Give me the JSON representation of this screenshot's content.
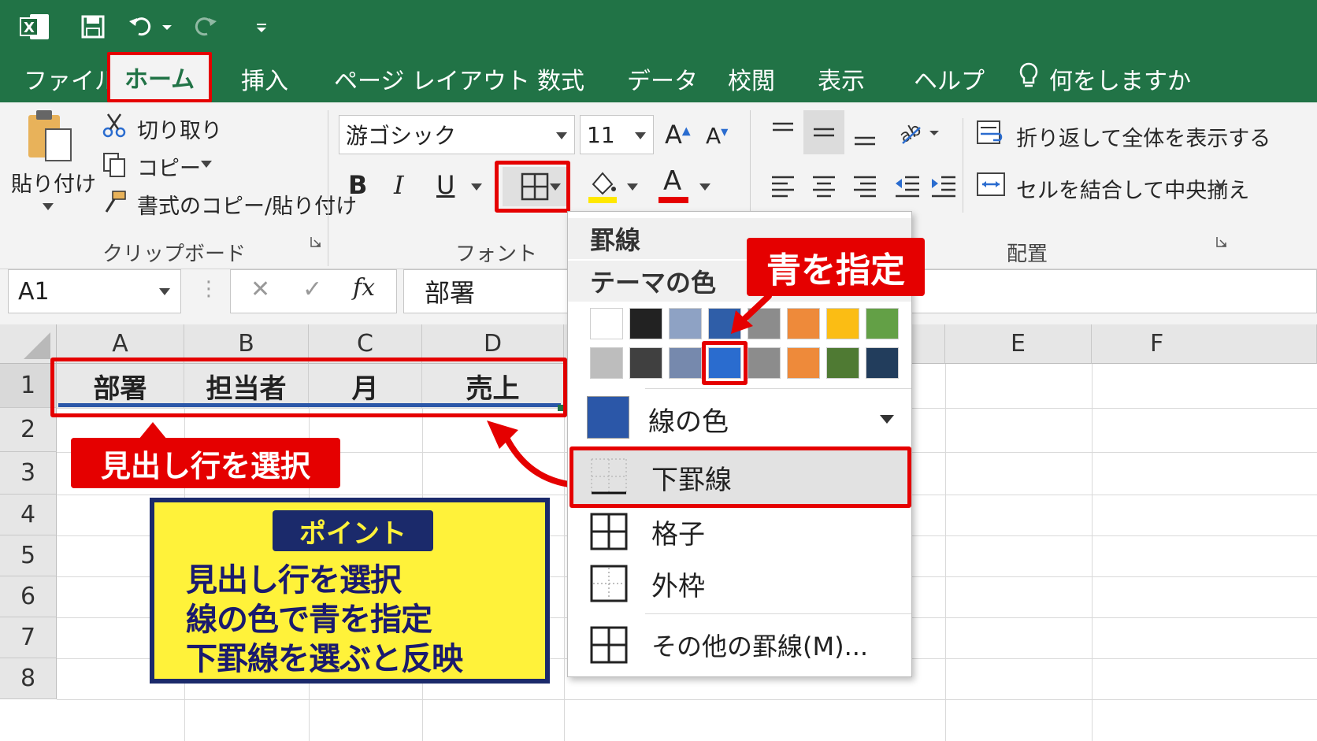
{
  "tabs": [
    "ファイル",
    "ホーム",
    "挿入",
    "ページ レイアウト",
    "数式",
    "データ",
    "校閲",
    "表示",
    "ヘルプ"
  ],
  "tell_me": "何をしますか",
  "clipboard": {
    "paste": "貼り付け",
    "cut": "切り取り",
    "copy": "コピー",
    "format_painter": "書式のコピー/貼り付け",
    "group": "クリップボード"
  },
  "font": {
    "name": "游ゴシック",
    "size": "11",
    "bold": "B",
    "italic": "I",
    "underline": "U",
    "grow": "A",
    "shrink": "A",
    "color_a": "A",
    "group": "フォント"
  },
  "alignment": {
    "wrap": "折り返して全体を表示する",
    "merge": "セルを結合して中央揃え",
    "group": "配置"
  },
  "formula_bar": {
    "name_box": "A1",
    "cancel": "✕",
    "enter": "✓",
    "fx": "fx",
    "content": "部署"
  },
  "columns": [
    "A",
    "B",
    "C",
    "D",
    "E",
    "F"
  ],
  "rows": [
    "1",
    "2",
    "3",
    "4",
    "5",
    "6",
    "7",
    "8"
  ],
  "header_cells": [
    "部署",
    "担当者",
    "月",
    "売上"
  ],
  "dropdown": {
    "title": "罫線",
    "theme_colors": "テーマの色",
    "swatches_row1": [
      "#ffffff",
      "#222222",
      "#8ea2c4",
      "#2f5ea8",
      "#8c8c8c",
      "#ee8a3a",
      "#fbbd14",
      "#63a046"
    ],
    "swatches_row2": [
      "#bdbdbd",
      "#404040",
      "#7689ad",
      "#2a6ccf",
      "#8c8c8c",
      "#ee8a3a",
      "#4f7a33",
      "#223d5c"
    ],
    "line_color": "線の色",
    "line_color_value": "#2b57a8",
    "items": [
      "下罫線",
      "格子",
      "外枠",
      "その他の罫線(M)..."
    ]
  },
  "callouts": {
    "blue": "青を指定",
    "select_header": "見出し行を選択",
    "point_title": "ポイント",
    "point_lines": [
      "見出し行を選択",
      "線の色で青を指定",
      "下罫線を選ぶと反映"
    ]
  },
  "colors": {
    "excel_green": "#217346",
    "highlight_red": "#e50000",
    "border_blue": "#2b57a8",
    "point_yellow": "#fff23a",
    "point_navy": "#1b2a6b"
  }
}
